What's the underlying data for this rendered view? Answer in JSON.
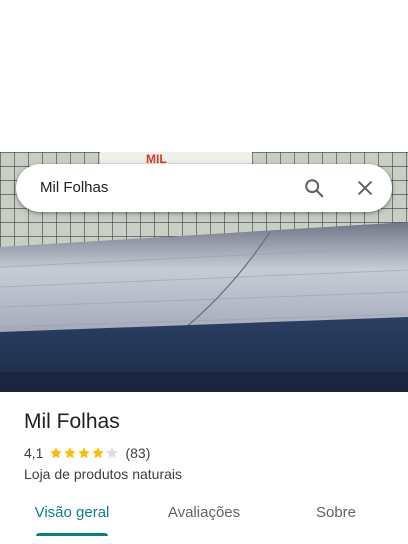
{
  "search": {
    "query": "Mil Folhas",
    "search_icon": "search-icon",
    "close_icon": "close-icon"
  },
  "photo": {
    "sign_text": "MIL"
  },
  "place": {
    "name": "Mil Folhas",
    "rating": "4,1",
    "rating_value": 4.1,
    "stars_max": 5,
    "reviews": "(83)",
    "category": "Loja de produtos naturais"
  },
  "tabs": [
    {
      "label": "Visão geral",
      "active": true
    },
    {
      "label": "Avaliações",
      "active": false
    },
    {
      "label": "Sobre",
      "active": false
    }
  ],
  "colors": {
    "accent": "#0a7f8c",
    "star_filled": "#fbbc04",
    "star_empty": "#dadce0"
  }
}
